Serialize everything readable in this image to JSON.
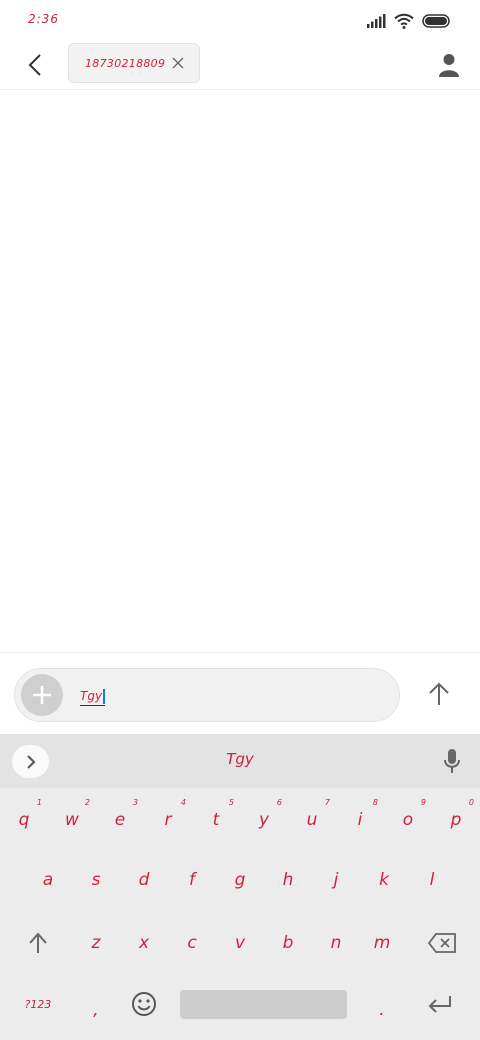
{
  "status": {
    "time": "2:36"
  },
  "header": {
    "recipient": "18730218809"
  },
  "compose": {
    "text": "Tgy"
  },
  "keyboard": {
    "suggestion": "Tgy",
    "row1": [
      {
        "letter": "q",
        "hint": "1"
      },
      {
        "letter": "w",
        "hint": "2"
      },
      {
        "letter": "e",
        "hint": "3"
      },
      {
        "letter": "r",
        "hint": "4"
      },
      {
        "letter": "t",
        "hint": "5"
      },
      {
        "letter": "y",
        "hint": "6"
      },
      {
        "letter": "u",
        "hint": "7"
      },
      {
        "letter": "i",
        "hint": "8"
      },
      {
        "letter": "o",
        "hint": "9"
      },
      {
        "letter": "p",
        "hint": "0"
      }
    ],
    "row2": [
      "a",
      "s",
      "d",
      "f",
      "g",
      "h",
      "j",
      "k",
      "l"
    ],
    "row3": [
      "z",
      "x",
      "c",
      "v",
      "b",
      "n",
      "m"
    ],
    "symbols_label": "?123",
    "comma": ",",
    "period": "."
  },
  "colors": {
    "accent": "#d3203f",
    "keyboard_bg": "#ececec",
    "strip_bg": "#e3e3e3"
  }
}
